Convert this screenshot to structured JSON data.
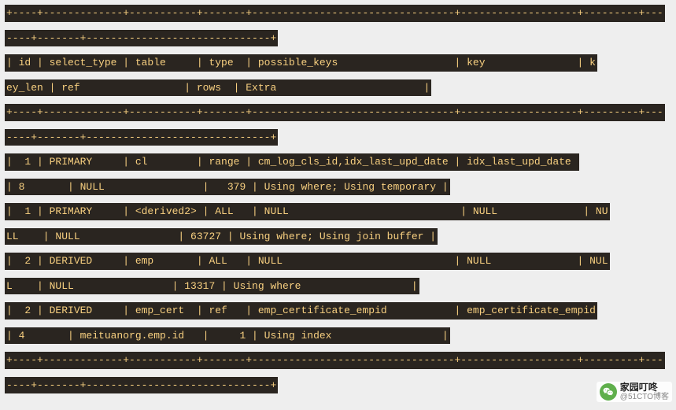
{
  "console": {
    "lines": [
      "+----+-------------+-----------+-------+---------------------------------+-------------------+---------+---",
      "----+-------+------------------------------+",
      "| id | select_type | table     | type  | possible_keys                   | key               | k",
      "ey_len | ref                 | rows  | Extra                        |",
      "+----+-------------+-----------+-------+---------------------------------+-------------------+---------+---",
      "----+-------+------------------------------+",
      "|  1 | PRIMARY     | cl        | range | cm_log_cls_id,idx_last_upd_date | idx_last_upd_date ",
      "| 8       | NULL                |   379 | Using where; Using temporary |",
      "|  1 | PRIMARY     | <derived2> | ALL   | NULL                            | NULL              | NU",
      "LL    | NULL                | 63727 | Using where; Using join buffer |",
      "|  2 | DERIVED     | emp       | ALL   | NULL                            | NULL              | NUL",
      "L    | NULL                | 13317 | Using where                  |",
      "|  2 | DERIVED     | emp_cert  | ref   | emp_certificate_empid           | emp_certificate_empid",
      "| 4       | meituanorg.emp.id   |     1 | Using index                  |",
      "+----+-------------+-----------+-------+---------------------------------+-------------------+---------+---",
      "----+-------+------------------------------+"
    ]
  },
  "chart_data": {
    "type": "table",
    "title": "",
    "columns": [
      "id",
      "select_type",
      "table",
      "type",
      "possible_keys",
      "key",
      "key_len",
      "ref",
      "rows",
      "Extra"
    ],
    "rows": [
      [
        1,
        "PRIMARY",
        "cl",
        "range",
        "cm_log_cls_id,idx_last_upd_date",
        "idx_last_upd_date",
        8,
        "NULL",
        379,
        "Using where; Using temporary"
      ],
      [
        1,
        "PRIMARY",
        "<derived2>",
        "ALL",
        "NULL",
        "NULL",
        "NULL",
        "NULL",
        63727,
        "Using where; Using join buffer"
      ],
      [
        2,
        "DERIVED",
        "emp",
        "ALL",
        "NULL",
        "NULL",
        "NULL",
        "NULL",
        13317,
        "Using where"
      ],
      [
        2,
        "DERIVED",
        "emp_cert",
        "ref",
        "emp_certificate_empid",
        "emp_certificate_empid",
        4,
        "meituanorg.emp.id",
        1,
        "Using index"
      ]
    ]
  },
  "watermark": {
    "name": "家园叮咚",
    "source": "@51CTO博客"
  }
}
